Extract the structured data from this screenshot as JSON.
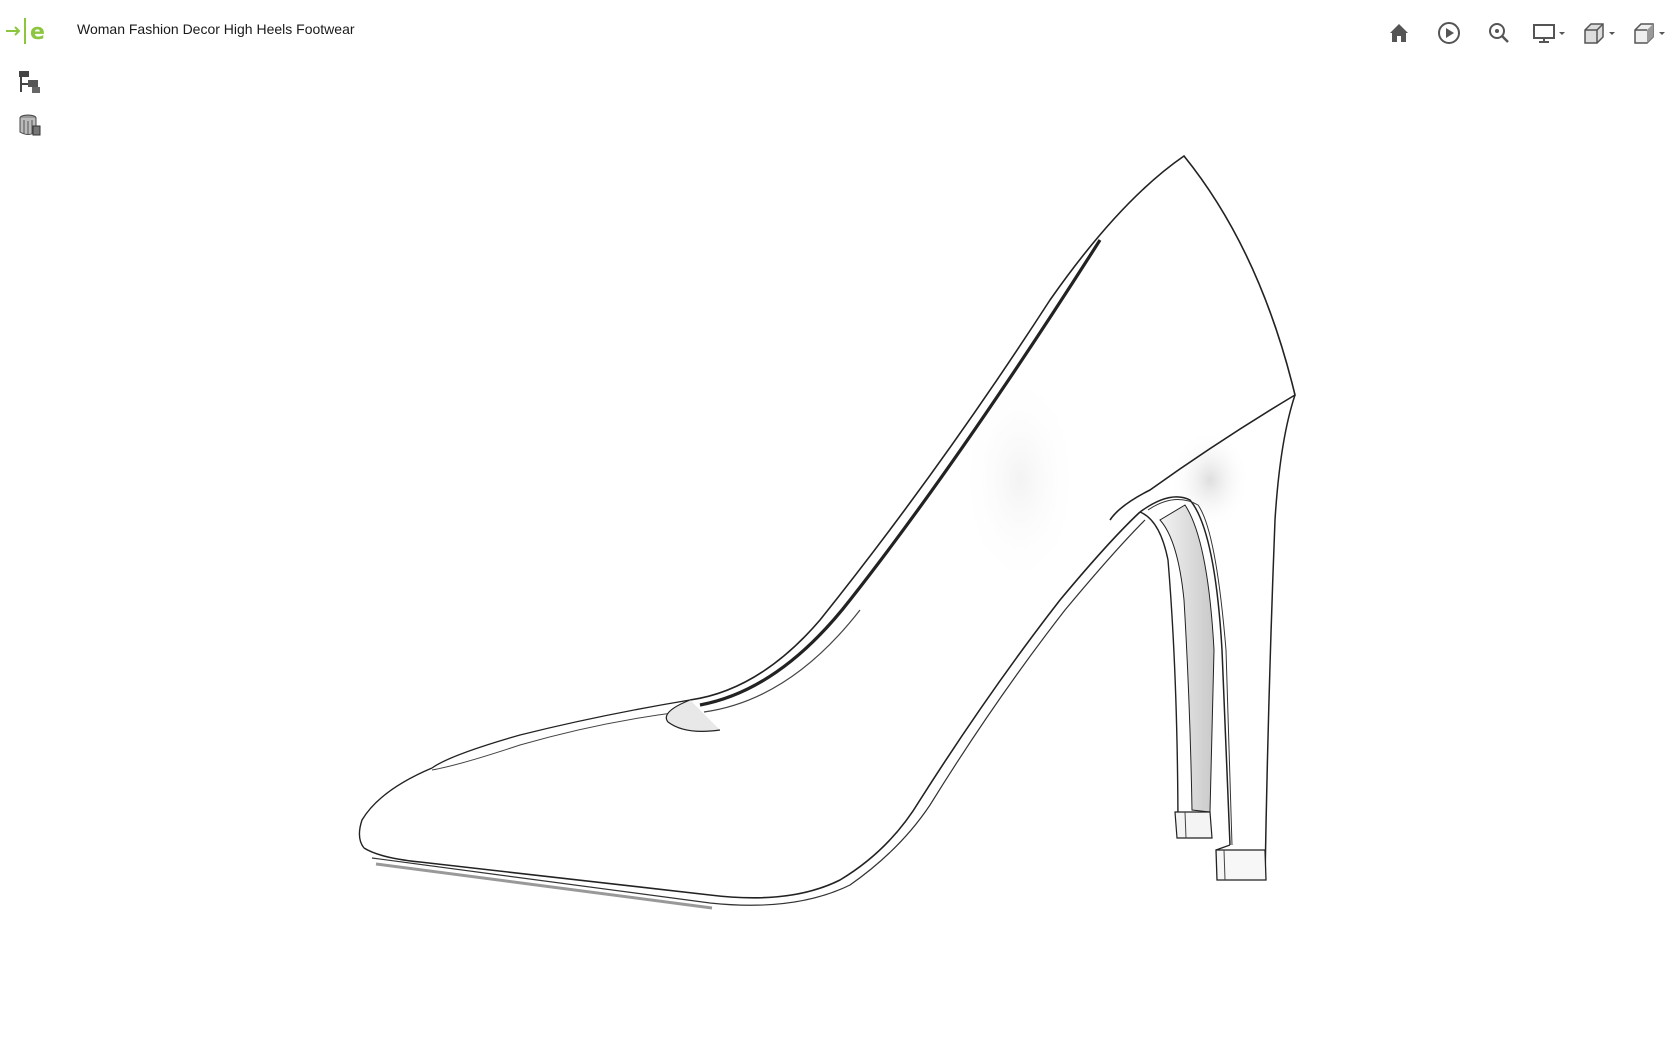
{
  "app": {
    "title": "Woman Fashion Decor High Heels Footwear",
    "logo_icon": "edrawings-logo-icon",
    "accent_color": "#8cc63f"
  },
  "side_tools": [
    {
      "icon": "model-tree-icon"
    },
    {
      "icon": "configurations-icon"
    }
  ],
  "toolbar": [
    {
      "icon": "home-icon"
    },
    {
      "icon": "play-icon"
    },
    {
      "icon": "zoom-search-icon"
    },
    {
      "icon": "display-monitor-icon",
      "has_dropdown": true
    },
    {
      "icon": "section-view-icon",
      "has_dropdown": true
    },
    {
      "icon": "view-cube-icon",
      "has_dropdown": true
    },
    {
      "icon": "help-icon"
    },
    {
      "icon": "exit-fullscreen-icon"
    }
  ],
  "viewport": {
    "model": "high-heel-shoe",
    "background": "#ffffff"
  }
}
